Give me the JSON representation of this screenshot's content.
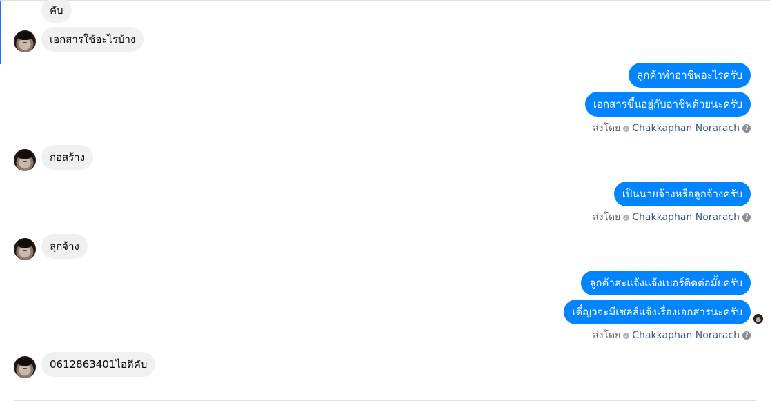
{
  "conversation": {
    "messages": [
      {
        "side": "incoming",
        "text": "คับ"
      },
      {
        "side": "incoming",
        "text": "เอกสารใช้อะไรบ้าง"
      },
      {
        "side": "outgoing",
        "text": "ลูกค้าทำอาชีพอะไรครับ"
      },
      {
        "side": "outgoing",
        "text": "เอกสารขึ้นอยู่กับอาชีพด้วยนะครับ"
      },
      {
        "side": "incoming",
        "text": "ก่อสร้าง"
      },
      {
        "side": "outgoing",
        "text": "เป็นนายจ้างหรือลูกจ้างครับ"
      },
      {
        "side": "incoming",
        "text": "ลุกจ้าง"
      },
      {
        "side": "outgoing",
        "text": "ลูกค้าสะแจ้งแจ้งเบอร์ติดต่อมั้ยครับ"
      },
      {
        "side": "outgoing",
        "text": "เดี๋ญวจะมีเซลล์แจ้งเรื่องเอกสารนะครับ"
      },
      {
        "side": "incoming",
        "text": "0612863401ไอดีคับ"
      }
    ],
    "sent_by": {
      "prefix": "ส่งโดย",
      "name": "Chakkaphan Norarach",
      "help": "?"
    }
  },
  "colors": {
    "outgoing_bubble": "#0084ff",
    "incoming_bubble": "#f0f0f0",
    "sent_by_name": "#385898",
    "accent": "#1877f2"
  },
  "icons": [
    "avatar",
    "seen-avatar",
    "sent-by-icon",
    "help-icon"
  ]
}
